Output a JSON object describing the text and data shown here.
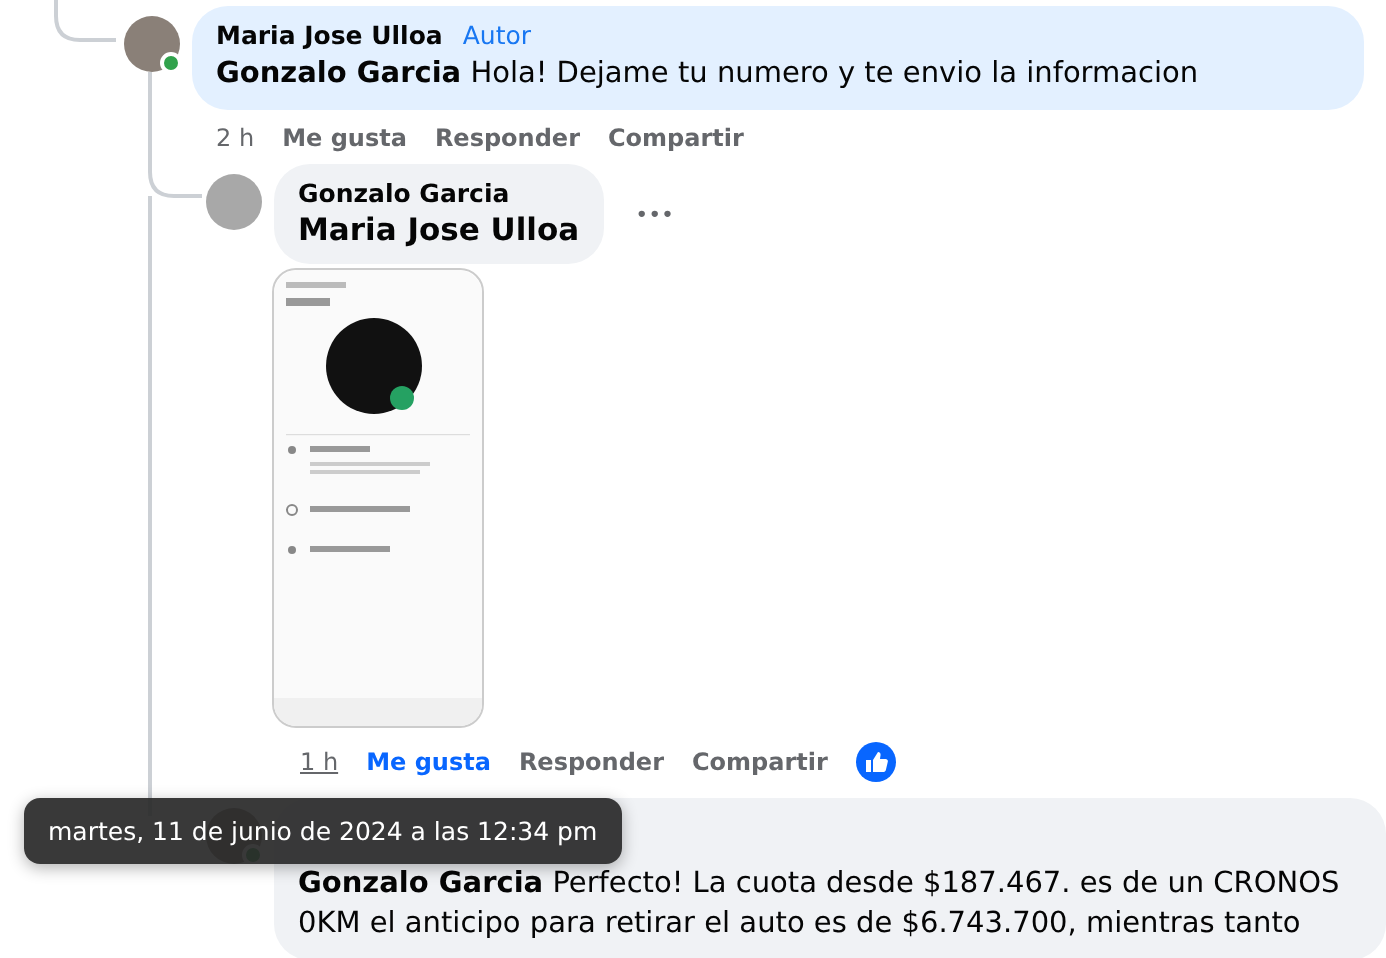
{
  "comments": [
    {
      "author": "Maria Jose Ulloa",
      "badge": "Autor",
      "online": true,
      "highlighted": true,
      "mention": "Gonzalo Garcia",
      "text": "Hola! Dejame tu numero y te envio la informacion",
      "time": "2 h",
      "time_hover": false,
      "like_label": "Me gusta",
      "liked": false,
      "reply_label": "Responder",
      "share_label": "Compartir"
    },
    {
      "author": "Gonzalo Garcia",
      "online": false,
      "highlighted": false,
      "mention": "Maria Jose Ulloa",
      "more": "•••",
      "attachment": {
        "kind": "phone-screenshot"
      },
      "time": "1 h",
      "time_hover": true,
      "like_label": "Me gusta",
      "liked": true,
      "reply_label": "Responder",
      "share_label": "Compartir"
    },
    {
      "online": true,
      "highlighted": false,
      "mention": "Gonzalo Garcia",
      "text": "Perfecto! La cuota desde $187.467. es de un CRONOS 0KM el anticipo para retirar el auto es de $6.743.700, mientras tanto"
    }
  ],
  "tooltip": {
    "text": "martes, 11 de junio de 2024 a las 12:34 pm"
  }
}
